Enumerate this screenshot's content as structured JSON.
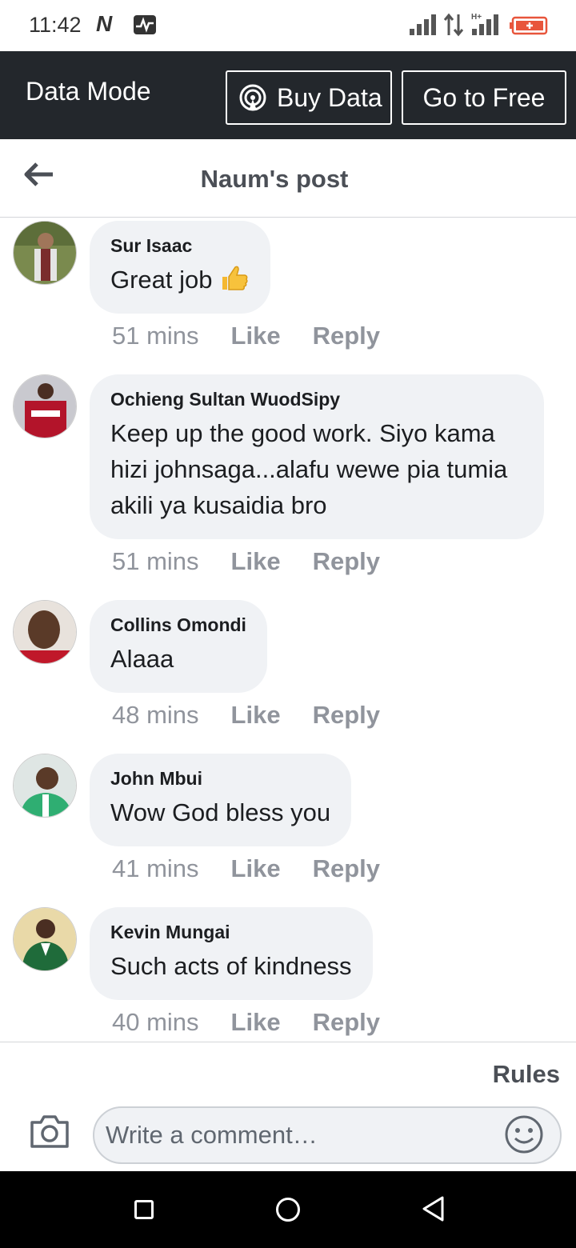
{
  "status_bar": {
    "time": "11:42",
    "notification_icons": [
      "netflix-n-icon",
      "pulse-icon"
    ],
    "system_icons": [
      "signal-icon",
      "data-arrows-icon",
      "signal-hplus-icon",
      "battery-low-icon"
    ],
    "network_label": "H+"
  },
  "data_bar": {
    "title": "Data Mode",
    "buy_label": "Buy Data",
    "free_label": "Go to Free"
  },
  "header": {
    "title": "Naum's post"
  },
  "comments": [
    {
      "author": "Sur Isaac",
      "text": "Great job",
      "emoji": "thumbs-up",
      "time": "51 mins",
      "like": "Like",
      "reply": "Reply"
    },
    {
      "author": "Ochieng Sultan WuodSipy",
      "text": "Keep up the good work. Siyo kama hizi johnsaga...alafu wewe pia tumia akili ya kusaidia bro",
      "time": "51 mins",
      "like": "Like",
      "reply": "Reply"
    },
    {
      "author": "Collins Omondi",
      "text": "Alaaa",
      "time": "48 mins",
      "like": "Like",
      "reply": "Reply"
    },
    {
      "author": "John Mbui",
      "text": "Wow God bless you",
      "time": "41 mins",
      "like": "Like",
      "reply": "Reply"
    },
    {
      "author": "Kevin Mungai",
      "text": "Such acts of kindness",
      "time": "40 mins",
      "like": "Like",
      "reply": "Reply"
    }
  ],
  "composer": {
    "rules_label": "Rules",
    "placeholder": "Write a comment…"
  },
  "colors": {
    "data_bar_bg": "#23272c",
    "bubble_bg": "#f0f2f5",
    "meta_text": "#90949c"
  }
}
